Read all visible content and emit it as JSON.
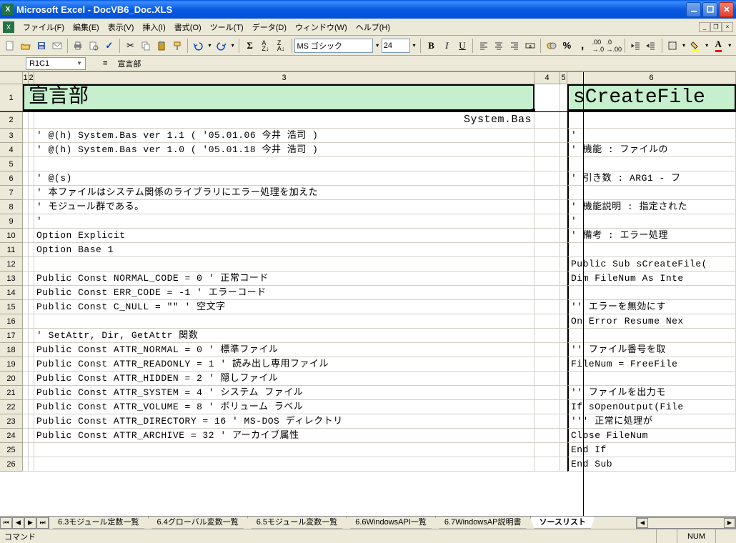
{
  "window": {
    "title": "Microsoft Excel - DocVB6_Doc.XLS"
  },
  "menus": {
    "file": "ファイル(F)",
    "edit": "編集(E)",
    "view": "表示(V)",
    "insert": "挿入(I)",
    "format": "書式(O)",
    "tools": "ツール(T)",
    "data": "データ(D)",
    "window": "ウィンドウ(W)",
    "help": "ヘルプ(H)"
  },
  "toolbar": {
    "font_name": "MS ゴシック",
    "font_size": "24"
  },
  "formulabar": {
    "namebox": "R1C1",
    "content": "宣言部"
  },
  "columns": [
    "1",
    "2",
    "3",
    "4",
    "5",
    "6"
  ],
  "headers": {
    "left": "宣言部",
    "right": "sCreateFile",
    "system_bas": "System.Bas"
  },
  "rows_left": {
    "3": "' @(h) System.Bas             ver 1.1 ( '05.01.06 今井 浩司 )",
    "4": "' @(h) System.Bas             ver 1.0 ( '05.01.18 今井 浩司 )",
    "5": "",
    "6": "' @(s)",
    "7": "'  本ファイルはシステム関係のライブラリにエラー処理を加えた",
    "8": "'  モジュール群である。",
    "9": "'",
    "10": "Option Explicit",
    "11": "Option Base 1",
    "12": "",
    "13": "Public Const NORMAL_CODE = 0       ' 正常コード",
    "14": "Public Const ERR_CODE = -1         ' エラーコード",
    "15": "Public Const C_NULL = \"\"           ' 空文字",
    "16": "",
    "17": "' SetAttr, Dir, GetAttr 関数",
    "18": "Public Const ATTR_NORMAL = 0       ' 標準ファイル",
    "19": "Public Const ATTR_READONLY = 1     ' 読み出し専用ファイル",
    "20": "Public Const ATTR_HIDDEN = 2       ' 隠しファイル",
    "21": "Public Const ATTR_SYSTEM = 4       ' システム ファイル",
    "22": "Public Const ATTR_VOLUME = 8       ' ボリューム ラベル",
    "23": "Public Const ATTR_DIRECTORY = 16   ' MS-DOS ディレクトリ",
    "24": "Public Const ATTR_ARCHIVE = 32     ' アーカイブ属性",
    "25": "",
    "26": ""
  },
  "rows_right": {
    "3": "'",
    "4": "' 機能      : ファイルの",
    "5": "",
    "6": "' 引き数    : ARG1 - フ",
    "7": "",
    "8": "' 機能説明  : 指定された",
    "9": "'",
    "10": "' 備考      : エラー処理",
    "11": "",
    "12": "Public Sub sCreateFile(",
    "13": "    Dim FileNum As Inte",
    "14": "",
    "15": "    '' エラーを無効にす",
    "16": "    On Error Resume Nex",
    "17": "",
    "18": "    '' ファイル番号を取",
    "19": "    FileNum = FreeFile",
    "20": "",
    "21": "    '' ファイルを出力モ",
    "22": "    If sOpenOutput(File",
    "23": "        ''' 正常に処理が",
    "24": "        Close FileNum",
    "25": "    End If",
    "26": "End Sub"
  },
  "sheet_tabs": {
    "t1": "6.3モジュール定数一覧",
    "t2": "6.4グローバル変数一覧",
    "t3": "6.5モジュール変数一覧",
    "t4": "6.6WindowsAPI一覧",
    "t5": "6.7WindowsAP説明書",
    "t6": "ソースリスト"
  },
  "statusbar": {
    "ready": "コマンド",
    "num": "NUM"
  }
}
